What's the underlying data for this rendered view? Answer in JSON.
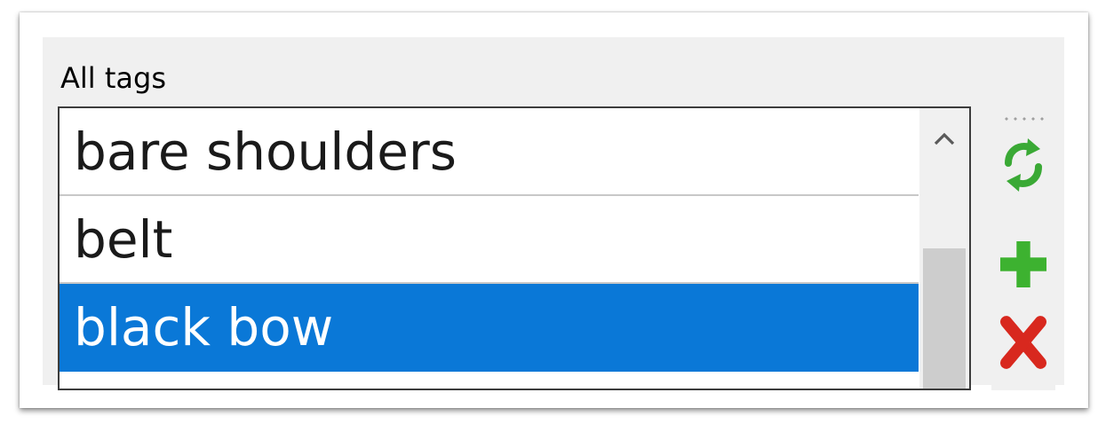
{
  "group": {
    "label": "All tags"
  },
  "list": {
    "items": [
      {
        "label": "bare shoulders",
        "selected": false
      },
      {
        "label": "belt",
        "selected": false
      },
      {
        "label": "black bow",
        "selected": true
      }
    ]
  },
  "toolbar": {
    "buttons": [
      {
        "icon": "refresh-icon",
        "color": "#3aa935"
      },
      {
        "icon": "plus-icon",
        "color": "#3db230"
      },
      {
        "icon": "delete-x-icon",
        "color": "#d8281e"
      }
    ]
  },
  "colors": {
    "selection": "#0a78d7",
    "panel": "#f0f0f0"
  }
}
